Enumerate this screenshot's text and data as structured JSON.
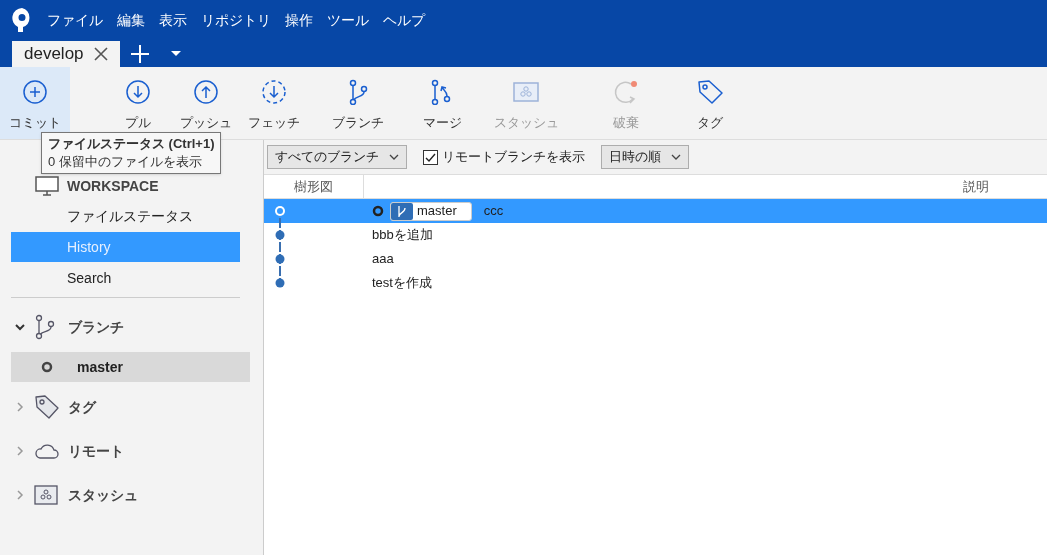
{
  "menu": [
    "ファイル",
    "編集",
    "表示",
    "リポジトリ",
    "操作",
    "ツール",
    "ヘルプ"
  ],
  "tabs": [
    {
      "label": "develop",
      "selected": true
    }
  ],
  "toolbar": [
    {
      "label": "コミット",
      "kind": "commit",
      "disabled": false,
      "selected": true
    },
    {
      "label": "プル",
      "kind": "pull",
      "disabled": false,
      "selected": false
    },
    {
      "label": "プッシュ",
      "kind": "push",
      "disabled": false,
      "selected": false
    },
    {
      "label": "フェッチ",
      "kind": "fetch",
      "disabled": false,
      "selected": false
    },
    {
      "label": "ブランチ",
      "kind": "branch",
      "disabled": false,
      "selected": false
    },
    {
      "label": "マージ",
      "kind": "merge",
      "disabled": false,
      "selected": false
    },
    {
      "label": "スタッシュ",
      "kind": "stash",
      "disabled": true,
      "selected": false
    },
    {
      "label": "破棄",
      "kind": "discard",
      "disabled": true,
      "selected": false
    },
    {
      "label": "タグ",
      "kind": "tag",
      "disabled": false,
      "selected": false
    }
  ],
  "tooltip": {
    "title": "ファイルステータス (Ctrl+1)",
    "text": "0 保留中のファイルを表示"
  },
  "sidebar": {
    "workspace": {
      "title": "WORKSPACE",
      "items": [
        {
          "label": "ファイルステータス",
          "selected": false
        },
        {
          "label": "History",
          "selected": true
        },
        {
          "label": "Search",
          "selected": false
        }
      ]
    },
    "sections": [
      {
        "label": "ブランチ",
        "kind": "branch",
        "expanded": true,
        "children": [
          {
            "label": "master",
            "selected": true
          }
        ]
      },
      {
        "label": "タグ",
        "kind": "tag",
        "expanded": false
      },
      {
        "label": "リモート",
        "kind": "remote",
        "expanded": false
      },
      {
        "label": "スタッシュ",
        "kind": "stash",
        "expanded": false
      }
    ]
  },
  "filters": {
    "branches": "すべてのブランチ",
    "show_remote": {
      "label": "リモートブランチを表示",
      "checked": true
    },
    "sort": "日時の順"
  },
  "table": {
    "columns": [
      "樹形図",
      "説明"
    ],
    "rows": [
      {
        "head": true,
        "branch": "master",
        "message": "ccc",
        "selected": true
      },
      {
        "head": false,
        "message": "bbbを追加",
        "selected": false
      },
      {
        "head": false,
        "message": "aaa",
        "selected": false
      },
      {
        "head": false,
        "message": "testを作成",
        "selected": false
      }
    ]
  }
}
